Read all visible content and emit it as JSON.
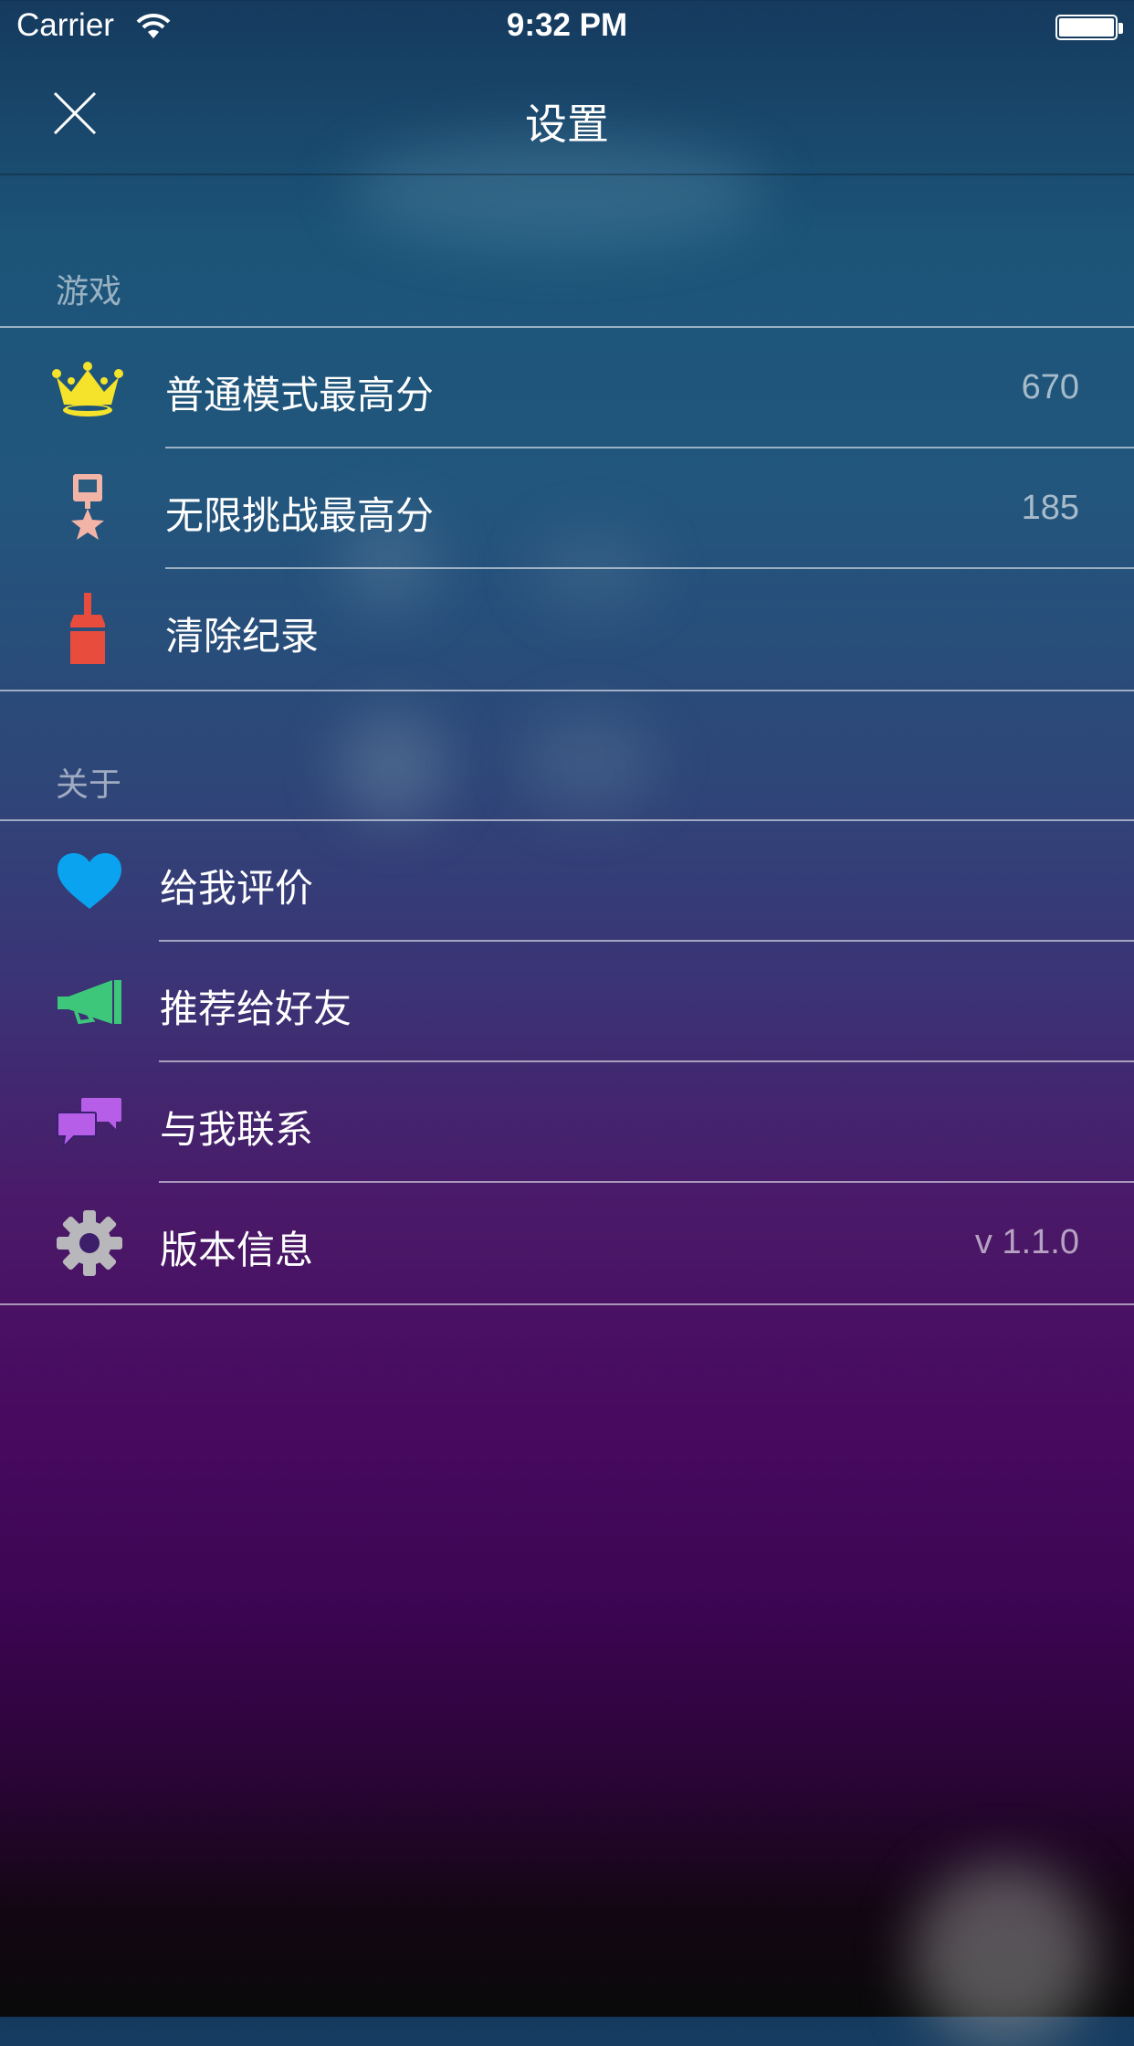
{
  "status_bar": {
    "carrier": "Carrier",
    "time": "9:32 PM"
  },
  "nav": {
    "title": "设置",
    "close_icon": "close-icon"
  },
  "sections": {
    "game": {
      "header": "游戏",
      "items": [
        {
          "icon": "crown-icon",
          "label": "普通模式最高分",
          "value": "670"
        },
        {
          "icon": "medal-icon",
          "label": "无限挑战最高分",
          "value": "185"
        },
        {
          "icon": "brush-icon",
          "label": "清除纪录",
          "value": ""
        }
      ]
    },
    "about": {
      "header": "关于",
      "items": [
        {
          "icon": "heart-icon",
          "label": "给我评价",
          "value": ""
        },
        {
          "icon": "megaphone-icon",
          "label": "推荐给好友",
          "value": ""
        },
        {
          "icon": "chat-icon",
          "label": "与我联系",
          "value": ""
        },
        {
          "icon": "gear-icon",
          "label": "版本信息",
          "value": "v 1.1.0"
        }
      ]
    }
  },
  "colors": {
    "crown": "#f5e22a",
    "medal": "#f3b4a8",
    "brush": "#e84c3d",
    "heart": "#0aa3f0",
    "megaphone": "#3cc77a",
    "chat": "#b65ee8",
    "gear": "#b8b8bc"
  }
}
